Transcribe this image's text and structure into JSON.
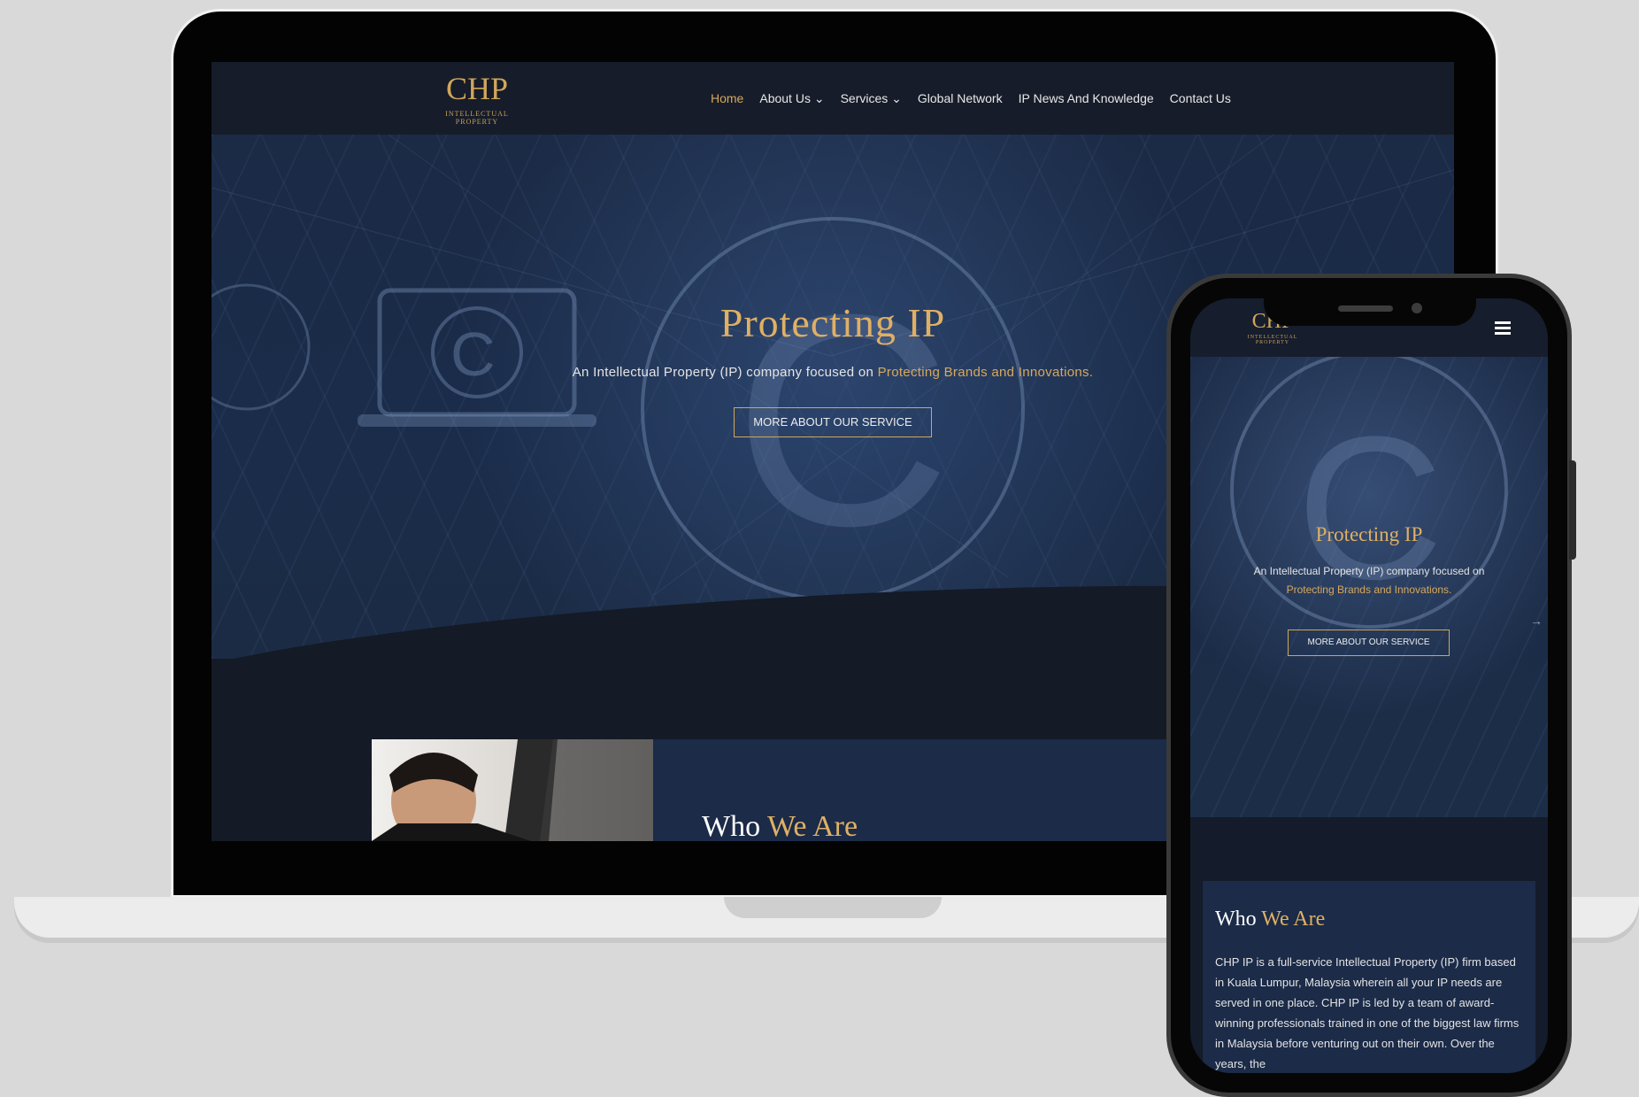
{
  "brand": {
    "monogram": "CHP",
    "tagline": "INTELLECTUAL PROPERTY",
    "gold": "#d8a85b",
    "navy": "#1b2b48"
  },
  "nav": {
    "items": [
      {
        "label": "Home",
        "active": true
      },
      {
        "label": "About Us",
        "has_dropdown": true
      },
      {
        "label": "Services",
        "has_dropdown": true
      },
      {
        "label": "Global Network"
      },
      {
        "label": "IP News And Knowledge"
      },
      {
        "label": "Contact Us"
      }
    ],
    "dropdown_glyph": "⌄"
  },
  "hero": {
    "title": "Protecting IP",
    "subtitle_lead": "An Intellectual Property (IP) company focused on ",
    "subtitle_highlight": "Protecting Brands and Innovations.",
    "button": "MORE ABOUT OUR SERVICE"
  },
  "who": {
    "title_plain": "Who ",
    "title_gold": "We Are",
    "body": "CHP IP is a full-service Intellectual Property (IP) firm based in Kuala Lumpur, Malaysia wherein all your IP needs are served in one place. CHP IP is led by a team of award-winning professionals trained in one of the biggest law firms in Malaysia before venturing out on their own. Over the years, the"
  },
  "mobile": {
    "menu_icon": "hamburger-icon",
    "subtitle_lead": "An Intellectual Property (IP) company focused on ",
    "subtitle_highlight": "Protecting Brands and Innovations.",
    "arrow_glyph": "→"
  }
}
